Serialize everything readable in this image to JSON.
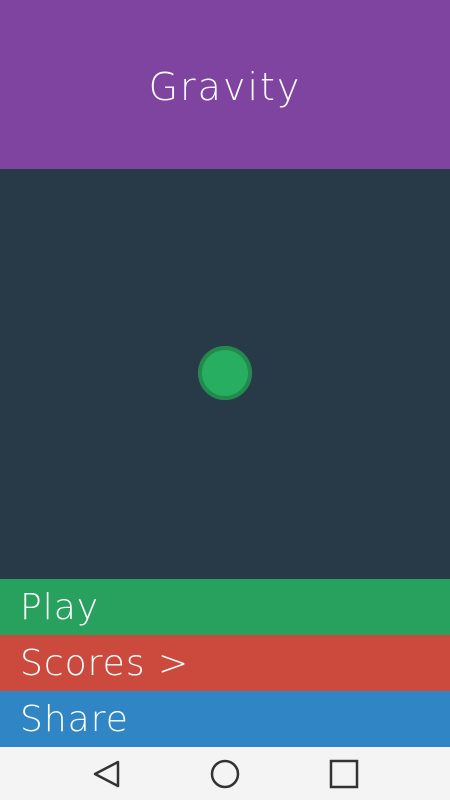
{
  "header": {
    "title": "Gravity"
  },
  "playfield": {
    "ball_color": "#27ae60"
  },
  "menu": {
    "play_label": "Play",
    "scores_label": "Scores >",
    "share_label": "Share"
  },
  "navbar": {
    "back_icon": "triangle-back-icon",
    "home_icon": "circle-home-icon",
    "recent_icon": "square-recent-apps-icon"
  },
  "colors": {
    "header": "#7f43a0",
    "background": "#283a48",
    "play": "#28a05e",
    "scores": "#cc4a3d",
    "share": "#3085c4",
    "navbar": "#f4f4f4"
  }
}
